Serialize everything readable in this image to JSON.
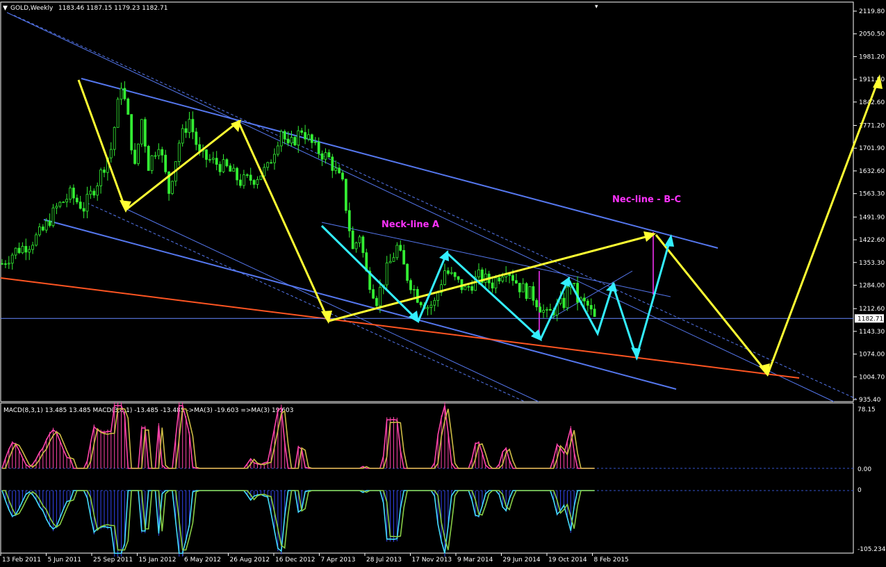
{
  "header": {
    "symbol": "GOLD,Weekly",
    "ohlc": "1183.46 1187.15 1179.23 1182.71"
  },
  "chart_data": [
    {
      "type": "candlestick",
      "title": "GOLD,Weekly",
      "y_ticks": [
        "2119.80",
        "2050.50",
        "1981.20",
        "1911.90",
        "1842.60",
        "1771.20",
        "1701.90",
        "1632.60",
        "1563.30",
        "1491.90",
        "1422.60",
        "1353.30",
        "1284.00",
        "1212.60",
        "1143.30",
        "1074.00",
        "1004.70",
        "935.40"
      ],
      "ylim": [
        935.4,
        2119.8
      ],
      "last_price": "1182.71",
      "last_price_value": 1182.71,
      "x_ticks": [
        "13 Feb 2011",
        "5 Jun 2011",
        "25 Sep 2011",
        "15 Jan 2012",
        "6 May 2012",
        "26 Aug 2012",
        "16 Dec 2012",
        "7 Apr 2013",
        "28 Jul 2013",
        "17 Nov 2013",
        "9 Mar 2014",
        "29 Jun 2014",
        "19 Oct 2014",
        "8 Feb 2015"
      ],
      "price_path": [
        [
          0,
          1350
        ],
        [
          4,
          1390
        ],
        [
          8,
          1410
        ],
        [
          12,
          1450
        ],
        [
          16,
          1520
        ],
        [
          20,
          1560
        ],
        [
          24,
          1520
        ],
        [
          28,
          1600
        ],
        [
          32,
          1700
        ],
        [
          35,
          1900
        ],
        [
          37,
          1790
        ],
        [
          39,
          1640
        ],
        [
          41,
          1790
        ],
        [
          43,
          1650
        ],
        [
          46,
          1720
        ],
        [
          49,
          1570
        ],
        [
          52,
          1720
        ],
        [
          55,
          1790
        ],
        [
          58,
          1680
        ],
        [
          62,
          1660
        ],
        [
          66,
          1640
        ],
        [
          70,
          1600
        ],
        [
          74,
          1610
        ],
        [
          78,
          1640
        ],
        [
          82,
          1760
        ],
        [
          84,
          1700
        ],
        [
          88,
          1760
        ],
        [
          92,
          1700
        ],
        [
          96,
          1670
        ],
        [
          100,
          1590
        ],
        [
          103,
          1390
        ],
        [
          105,
          1440
        ],
        [
          107,
          1320
        ],
        [
          110,
          1240
        ],
        [
          113,
          1330
        ],
        [
          116,
          1400
        ],
        [
          119,
          1310
        ],
        [
          122,
          1250
        ],
        [
          125,
          1220
        ],
        [
          127,
          1230
        ],
        [
          130,
          1330
        ],
        [
          133,
          1300
        ],
        [
          136,
          1270
        ],
        [
          140,
          1310
        ],
        [
          144,
          1290
        ],
        [
          148,
          1340
        ],
        [
          152,
          1280
        ],
        [
          156,
          1250
        ],
        [
          160,
          1190
        ],
        [
          162,
          1210
        ],
        [
          165,
          1230
        ],
        [
          167,
          1300
        ],
        [
          169,
          1240
        ],
        [
          172,
          1220
        ],
        [
          174,
          1180
        ]
      ],
      "annotations": {
        "neck_line_a": "Neck-line A",
        "nec_line_bc": "Nec-line - B-C"
      }
    },
    {
      "type": "line",
      "title": "MACD(8,3,1) 13.485 13.485  MACD(3,8,1) -13.485 -13.485  ->MA(3) -19.603  =>MA(3) 19.603",
      "y_ticks": [
        "78.15",
        "0.00",
        "0",
        "-105.234"
      ],
      "ylim": [
        -105.234,
        78.15
      ],
      "series": [
        {
          "name": "MACD(8,3,1)",
          "color": "#ff44aa"
        },
        {
          "name": "MACD(3,8,1)",
          "color": "#44ddff"
        },
        {
          "name": "->MA(3)",
          "color": "#ccbb44"
        },
        {
          "name": "=>MA(3)",
          "color": "#88cc44"
        }
      ]
    }
  ],
  "colors": {
    "background": "#000000",
    "candle": "#33ee33",
    "yellow_wave": "#ffff33",
    "cyan_wave": "#33eeff",
    "channel": "#5577ee",
    "support": "#ff5522",
    "magenta": "#ff33ff"
  }
}
